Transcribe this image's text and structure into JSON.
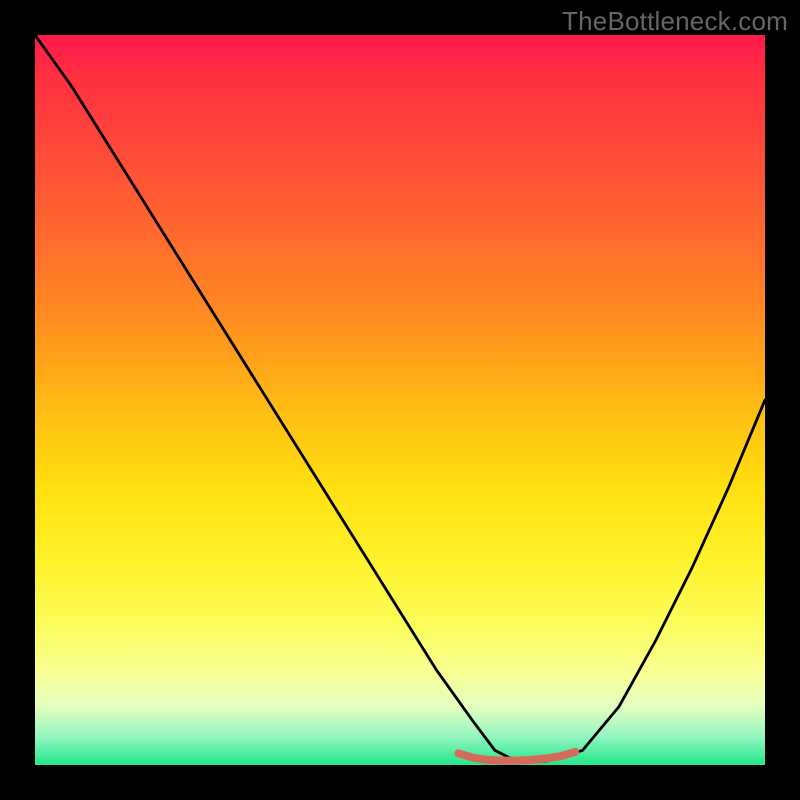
{
  "watermark": {
    "text": "TheBottleneck.com"
  },
  "chart_data": {
    "type": "line",
    "title": "",
    "xlabel": "",
    "ylabel": "",
    "xlim": [
      0,
      100
    ],
    "ylim": [
      0,
      100
    ],
    "background": {
      "type": "vertical-gradient",
      "stops": [
        {
          "pos": 0,
          "color": "#ff1a4d"
        },
        {
          "pos": 22,
          "color": "#ff5a34"
        },
        {
          "pos": 50,
          "color": "#ffb814"
        },
        {
          "pos": 72,
          "color": "#fff22a"
        },
        {
          "pos": 92,
          "color": "#e4ffc0"
        },
        {
          "pos": 100,
          "color": "#22e88a"
        }
      ]
    },
    "series": [
      {
        "name": "bottleneck-curve",
        "color": "#000000",
        "width": 2.8,
        "x": [
          0,
          5,
          10,
          15,
          20,
          25,
          30,
          35,
          40,
          45,
          50,
          55,
          60,
          63,
          66,
          70,
          75,
          80,
          85,
          90,
          95,
          100
        ],
        "y": [
          100,
          93,
          85,
          77,
          69,
          61,
          53,
          45,
          37,
          29,
          21,
          13,
          6,
          2,
          0.5,
          0.5,
          2,
          8,
          17,
          27,
          38,
          50
        ]
      },
      {
        "name": "sweet-spot-marker",
        "color": "#d46a5a",
        "width": 8,
        "x": [
          58,
          60,
          62,
          64,
          66,
          68,
          70,
          72,
          74
        ],
        "y": [
          1.6,
          1.0,
          0.7,
          0.6,
          0.6,
          0.7,
          0.9,
          1.2,
          1.8
        ]
      }
    ],
    "annotations": []
  }
}
